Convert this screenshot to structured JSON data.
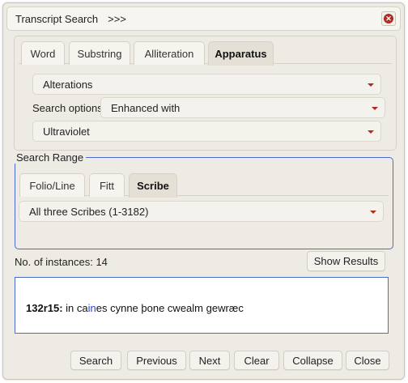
{
  "titlebar": {
    "title": "Transcript Search",
    "arrows": ">>>"
  },
  "tabs": [
    {
      "label": "Word"
    },
    {
      "label": "Substring"
    },
    {
      "label": "Alliteration"
    },
    {
      "label": "Apparatus",
      "active": true
    }
  ],
  "apparatus": {
    "type_select": "Alterations",
    "options_label": "Search options:",
    "options_select": "Enhanced with",
    "enhancement_select": "Ultraviolet"
  },
  "search_range": {
    "legend": "Search Range",
    "tabs": [
      {
        "label": "Folio/Line"
      },
      {
        "label": "Fitt"
      },
      {
        "label": "Scribe",
        "active": true
      }
    ],
    "scribe_select": "All three Scribes (1-3182)"
  },
  "instances": {
    "label": "No. of instances: 14"
  },
  "show_results_label": "Show Results",
  "result": {
    "ref": "132r15:",
    "pre": " in ca",
    "highlight": "in",
    "post": "es cynne þone cwealm gewræc"
  },
  "buttons": {
    "search": "Search",
    "previous": "Previous",
    "next": "Next",
    "clear": "Clear",
    "collapse": "Collapse",
    "close": "Close"
  },
  "colors": {
    "accent_blue": "#4a6ccd",
    "caret_red": "#b22a1f",
    "highlight": "#2f3fc9",
    "background": "#eeebe4"
  }
}
